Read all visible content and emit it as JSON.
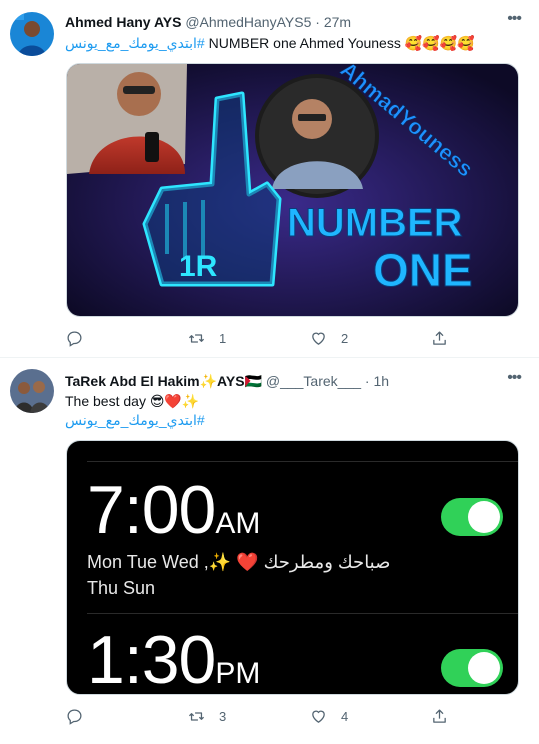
{
  "tweets": [
    {
      "display_name": "Ahmed Hany AYS",
      "handle": "@AhmedHanyAYS5",
      "separator": "·",
      "time": "27m",
      "hashtag": "#ابتدي_يومك_مع_يونس",
      "body": "NUMBER one Ahmed Youness",
      "emojis": "🥰🥰🥰🥰",
      "media": {
        "overlay_texts": [
          "AhmadYouness",
          "NUMBER",
          "ONE",
          "1R"
        ]
      },
      "actions": {
        "replies": "",
        "retweets": "1",
        "likes": "2"
      }
    },
    {
      "display_name": "TaRek Abd El Hakim✨AYS🇵🇸",
      "handle": "@___Tarek___",
      "separator": "·",
      "time": "1h",
      "body": "The best day 😎❤️✨",
      "hashtag": "#ابتدي_يومك_مع_يونس",
      "media": {
        "alarms": [
          {
            "time": "7:00",
            "ampm": "AM",
            "label_line1": "Mon Tue Wed ,✨ ❤️ صباحك ومطرحك",
            "label_line2": "Thu Sun",
            "enabled": true
          },
          {
            "time": "1:30",
            "ampm": "PM",
            "label_line1": "",
            "label_line2": "",
            "enabled": true
          }
        ]
      },
      "actions": {
        "replies": "",
        "retweets": "3",
        "likes": "4"
      }
    }
  ],
  "icons": {
    "reply": "reply-icon",
    "retweet": "retweet-icon",
    "like": "heart-icon",
    "share": "share-icon",
    "more": "more-icon"
  },
  "colors": {
    "accent": "#1d9bf0",
    "toggle_on": "#30d158",
    "neon": "#2ee6ff"
  }
}
